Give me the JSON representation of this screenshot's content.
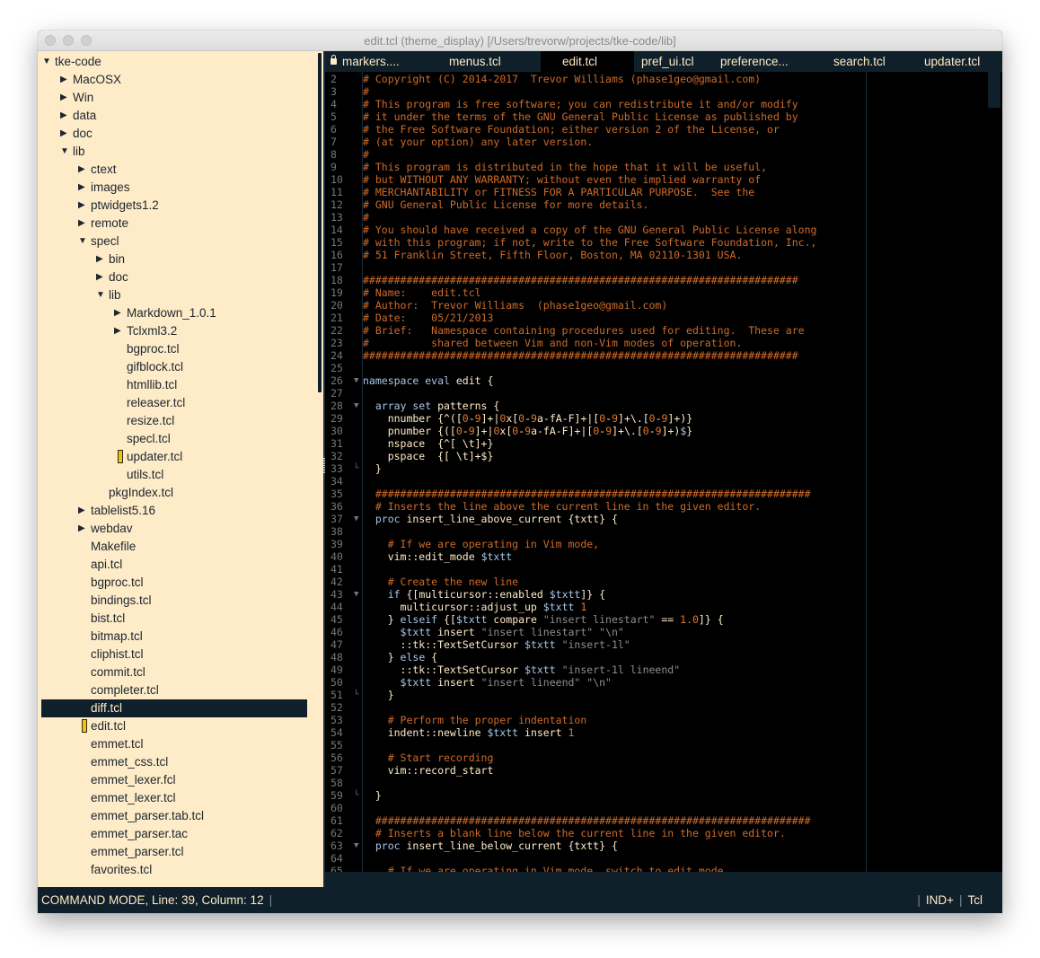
{
  "window": {
    "title": "edit.tcl (theme_display) [/Users/trevorw/projects/tke-code/lib]",
    "traffic_lights": [
      "close",
      "minimize",
      "zoom"
    ]
  },
  "colors": {
    "sidebar_bg": "#feebc7",
    "chrome_bg": "#0f202b",
    "editor_bg": "#000000",
    "comment": "#ce6b2a",
    "keyword": "#a9c6e6",
    "string": "#8e8e8e",
    "number": "#e3782c",
    "text": "#feebc7",
    "modified_marker": "#f5c400"
  },
  "sidebar": {
    "items": [
      {
        "label": "tke-code",
        "depth": 0,
        "type": "folder",
        "expanded": true
      },
      {
        "label": "MacOSX",
        "depth": 1,
        "type": "folder",
        "expanded": false
      },
      {
        "label": "Win",
        "depth": 1,
        "type": "folder",
        "expanded": false
      },
      {
        "label": "data",
        "depth": 1,
        "type": "folder",
        "expanded": false
      },
      {
        "label": "doc",
        "depth": 1,
        "type": "folder",
        "expanded": false
      },
      {
        "label": "lib",
        "depth": 1,
        "type": "folder",
        "expanded": true
      },
      {
        "label": "ctext",
        "depth": 2,
        "type": "folder",
        "expanded": false
      },
      {
        "label": "images",
        "depth": 2,
        "type": "folder",
        "expanded": false
      },
      {
        "label": "ptwidgets1.2",
        "depth": 2,
        "type": "folder",
        "expanded": false
      },
      {
        "label": "remote",
        "depth": 2,
        "type": "folder",
        "expanded": false
      },
      {
        "label": "specl",
        "depth": 2,
        "type": "folder",
        "expanded": true
      },
      {
        "label": "bin",
        "depth": 3,
        "type": "folder",
        "expanded": false
      },
      {
        "label": "doc",
        "depth": 3,
        "type": "folder",
        "expanded": false
      },
      {
        "label": "lib",
        "depth": 3,
        "type": "folder",
        "expanded": true
      },
      {
        "label": "Markdown_1.0.1",
        "depth": 4,
        "type": "folder",
        "expanded": false
      },
      {
        "label": "Tclxml3.2",
        "depth": 4,
        "type": "folder",
        "expanded": false
      },
      {
        "label": "bgproc.tcl",
        "depth": 4,
        "type": "file"
      },
      {
        "label": "gifblock.tcl",
        "depth": 4,
        "type": "file"
      },
      {
        "label": "htmllib.tcl",
        "depth": 4,
        "type": "file"
      },
      {
        "label": "releaser.tcl",
        "depth": 4,
        "type": "file"
      },
      {
        "label": "resize.tcl",
        "depth": 4,
        "type": "file"
      },
      {
        "label": "specl.tcl",
        "depth": 4,
        "type": "file"
      },
      {
        "label": "updater.tcl",
        "depth": 4,
        "type": "file",
        "open": true
      },
      {
        "label": "utils.tcl",
        "depth": 4,
        "type": "file"
      },
      {
        "label": "pkgIndex.tcl",
        "depth": 3,
        "type": "file"
      },
      {
        "label": "tablelist5.16",
        "depth": 2,
        "type": "folder",
        "expanded": false
      },
      {
        "label": "webdav",
        "depth": 2,
        "type": "folder",
        "expanded": false
      },
      {
        "label": "Makefile",
        "depth": 2,
        "type": "file"
      },
      {
        "label": "api.tcl",
        "depth": 2,
        "type": "file"
      },
      {
        "label": "bgproc.tcl",
        "depth": 2,
        "type": "file"
      },
      {
        "label": "bindings.tcl",
        "depth": 2,
        "type": "file"
      },
      {
        "label": "bist.tcl",
        "depth": 2,
        "type": "file"
      },
      {
        "label": "bitmap.tcl",
        "depth": 2,
        "type": "file"
      },
      {
        "label": "cliphist.tcl",
        "depth": 2,
        "type": "file"
      },
      {
        "label": "commit.tcl",
        "depth": 2,
        "type": "file"
      },
      {
        "label": "completer.tcl",
        "depth": 2,
        "type": "file"
      },
      {
        "label": "diff.tcl",
        "depth": 2,
        "type": "file",
        "selected": true
      },
      {
        "label": "edit.tcl",
        "depth": 2,
        "type": "file",
        "open": true
      },
      {
        "label": "emmet.tcl",
        "depth": 2,
        "type": "file"
      },
      {
        "label": "emmet_css.tcl",
        "depth": 2,
        "type": "file"
      },
      {
        "label": "emmet_lexer.fcl",
        "depth": 2,
        "type": "file"
      },
      {
        "label": "emmet_lexer.tcl",
        "depth": 2,
        "type": "file"
      },
      {
        "label": "emmet_parser.tab.tcl",
        "depth": 2,
        "type": "file"
      },
      {
        "label": "emmet_parser.tac",
        "depth": 2,
        "type": "file"
      },
      {
        "label": "emmet_parser.tcl",
        "depth": 2,
        "type": "file"
      },
      {
        "label": "favorites.tcl",
        "depth": 2,
        "type": "file"
      }
    ]
  },
  "tabs": [
    {
      "label": "markers....",
      "locked": true,
      "active": false
    },
    {
      "label": "menus.tcl",
      "active": false
    },
    {
      "label": "edit.tcl",
      "active": true
    },
    {
      "label": "pref_ui.tcl",
      "active": false
    },
    {
      "label": "preference...",
      "active": false
    },
    {
      "label": "search.tcl",
      "active": false
    },
    {
      "label": "updater.tcl",
      "active": false
    }
  ],
  "editor": {
    "lines": [
      {
        "n": 2,
        "t": [
          [
            "com",
            "# Copyright (C) 2014-2017  Trevor Williams (phase1geo@gmail.com)"
          ]
        ]
      },
      {
        "n": 3,
        "t": [
          [
            "com",
            "#"
          ]
        ]
      },
      {
        "n": 4,
        "t": [
          [
            "com",
            "# This program is free software; you can redistribute it and/or modify"
          ]
        ]
      },
      {
        "n": 5,
        "t": [
          [
            "com",
            "# it under the terms of the GNU General Public License as published by"
          ]
        ]
      },
      {
        "n": 6,
        "t": [
          [
            "com",
            "# the Free Software Foundation; either version 2 of the License, or"
          ]
        ]
      },
      {
        "n": 7,
        "t": [
          [
            "com",
            "# (at your option) any later version."
          ]
        ]
      },
      {
        "n": 8,
        "t": [
          [
            "com",
            "#"
          ]
        ]
      },
      {
        "n": 9,
        "t": [
          [
            "com",
            "# This program is distributed in the hope that it will be useful,"
          ]
        ]
      },
      {
        "n": 10,
        "t": [
          [
            "com",
            "# but WITHOUT ANY WARRANTY; without even the implied warranty of"
          ]
        ]
      },
      {
        "n": 11,
        "t": [
          [
            "com",
            "# MERCHANTABILITY or FITNESS FOR A PARTICULAR PURPOSE.  See the"
          ]
        ]
      },
      {
        "n": 12,
        "t": [
          [
            "com",
            "# GNU General Public License for more details."
          ]
        ]
      },
      {
        "n": 13,
        "t": [
          [
            "com",
            "#"
          ]
        ]
      },
      {
        "n": 14,
        "t": [
          [
            "com",
            "# You should have received a copy of the GNU General Public License along"
          ]
        ]
      },
      {
        "n": 15,
        "t": [
          [
            "com",
            "# with this program; if not, write to the Free Software Foundation, Inc.,"
          ]
        ]
      },
      {
        "n": 16,
        "t": [
          [
            "com",
            "# 51 Franklin Street, Fifth Floor, Boston, MA 02110-1301 USA."
          ]
        ]
      },
      {
        "n": 17,
        "t": []
      },
      {
        "n": 18,
        "t": [
          [
            "com",
            "######################################################################"
          ]
        ]
      },
      {
        "n": 19,
        "t": [
          [
            "com",
            "# Name:    edit.tcl"
          ]
        ]
      },
      {
        "n": 20,
        "t": [
          [
            "com",
            "# Author:  Trevor Williams  (phase1geo@gmail.com)"
          ]
        ]
      },
      {
        "n": 21,
        "t": [
          [
            "com",
            "# Date:    05/21/2013"
          ]
        ]
      },
      {
        "n": 22,
        "t": [
          [
            "com",
            "# Brief:   Namespace containing procedures used for editing.  These are"
          ]
        ]
      },
      {
        "n": 23,
        "t": [
          [
            "com",
            "#          shared between Vim and non-Vim modes of operation."
          ]
        ]
      },
      {
        "n": 24,
        "t": [
          [
            "com",
            "######################################################################"
          ]
        ]
      },
      {
        "n": 25,
        "t": []
      },
      {
        "n": 26,
        "fold": "open",
        "t": [
          [
            "kw",
            "namespace eval"
          ],
          [
            "txt",
            " edit {"
          ]
        ]
      },
      {
        "n": 27,
        "t": []
      },
      {
        "n": 28,
        "fold": "open",
        "t": [
          [
            "kw",
            "  array set"
          ],
          [
            "txt",
            " patterns {"
          ]
        ]
      },
      {
        "n": 29,
        "t": [
          [
            "txt",
            "    nnumber {^(["
          ],
          [
            "num",
            "0"
          ],
          [
            "txt",
            "-"
          ],
          [
            "num",
            "9"
          ],
          [
            "txt",
            "]+|"
          ],
          [
            "num",
            "0"
          ],
          [
            "txt",
            "x["
          ],
          [
            "num",
            "0"
          ],
          [
            "txt",
            "-"
          ],
          [
            "num",
            "9"
          ],
          [
            "txt",
            "a-fA-F]+|["
          ],
          [
            "num",
            "0"
          ],
          [
            "txt",
            "-"
          ],
          [
            "num",
            "9"
          ],
          [
            "txt",
            "]+\\.["
          ],
          [
            "num",
            "0"
          ],
          [
            "txt",
            "-"
          ],
          [
            "num",
            "9"
          ],
          [
            "txt",
            "]+)}"
          ]
        ]
      },
      {
        "n": 30,
        "t": [
          [
            "txt",
            "    pnumber {(["
          ],
          [
            "num",
            "0"
          ],
          [
            "txt",
            "-"
          ],
          [
            "num",
            "9"
          ],
          [
            "txt",
            "]+|"
          ],
          [
            "num",
            "0"
          ],
          [
            "txt",
            "x["
          ],
          [
            "num",
            "0"
          ],
          [
            "txt",
            "-"
          ],
          [
            "num",
            "9"
          ],
          [
            "txt",
            "a-fA-F]+|["
          ],
          [
            "num",
            "0"
          ],
          [
            "txt",
            "-"
          ],
          [
            "num",
            "9"
          ],
          [
            "txt",
            "]+\\.["
          ],
          [
            "num",
            "0"
          ],
          [
            "txt",
            "-"
          ],
          [
            "num",
            "9"
          ],
          [
            "txt",
            "]+)"
          ],
          [
            "var",
            "$"
          ],
          [
            "txt",
            "}"
          ]
        ]
      },
      {
        "n": 31,
        "t": [
          [
            "txt",
            "    nspace  {^[ \\t]+}"
          ]
        ]
      },
      {
        "n": 32,
        "t": [
          [
            "txt",
            "    pspace  {[ \\t]+$}"
          ]
        ]
      },
      {
        "n": 33,
        "fold": "end",
        "t": [
          [
            "txt",
            "  }"
          ]
        ]
      },
      {
        "n": 34,
        "t": []
      },
      {
        "n": 35,
        "t": [
          [
            "com",
            "  ######################################################################"
          ]
        ]
      },
      {
        "n": 36,
        "t": [
          [
            "com",
            "  # Inserts the line above the current line in the given editor."
          ]
        ]
      },
      {
        "n": 37,
        "fold": "open",
        "t": [
          [
            "kw",
            "  proc"
          ],
          [
            "txt",
            " insert_line_above_current {txtt} {"
          ]
        ]
      },
      {
        "n": 38,
        "t": []
      },
      {
        "n": 39,
        "t": [
          [
            "com",
            "    # If we are operating in Vim mode,"
          ]
        ]
      },
      {
        "n": 40,
        "t": [
          [
            "txt",
            "    vim::edit_mode "
          ],
          [
            "var",
            "$txtt"
          ]
        ]
      },
      {
        "n": 41,
        "t": []
      },
      {
        "n": 42,
        "t": [
          [
            "com",
            "    # Create the new line"
          ]
        ]
      },
      {
        "n": 43,
        "fold": "open",
        "t": [
          [
            "kw",
            "    if"
          ],
          [
            "txt",
            " {[multicursor::enabled "
          ],
          [
            "var",
            "$txtt"
          ],
          [
            "txt",
            "]} {"
          ]
        ]
      },
      {
        "n": 44,
        "t": [
          [
            "txt",
            "      multicursor::adjust_up "
          ],
          [
            "var",
            "$txtt"
          ],
          [
            "num",
            " 1"
          ]
        ]
      },
      {
        "n": 45,
        "t": [
          [
            "txt",
            "    } "
          ],
          [
            "kw",
            "elseif"
          ],
          [
            "txt",
            " {["
          ],
          [
            "var",
            "$txtt"
          ],
          [
            "txt",
            " compare "
          ],
          [
            "str",
            "\"insert linestart\""
          ],
          [
            "txt",
            " == "
          ],
          [
            "num",
            "1.0"
          ],
          [
            "txt",
            "]} {"
          ]
        ]
      },
      {
        "n": 46,
        "t": [
          [
            "var",
            "      $txtt"
          ],
          [
            "txt",
            " insert "
          ],
          [
            "str",
            "\"insert linestart\" \"\\n\""
          ]
        ]
      },
      {
        "n": 47,
        "t": [
          [
            "txt",
            "      ::tk::TextSetCursor "
          ],
          [
            "var",
            "$txtt"
          ],
          [
            "str",
            " \"insert-1l\""
          ]
        ]
      },
      {
        "n": 48,
        "t": [
          [
            "txt",
            "    } "
          ],
          [
            "kw",
            "else"
          ],
          [
            "txt",
            " {"
          ]
        ]
      },
      {
        "n": 49,
        "t": [
          [
            "txt",
            "      ::tk::TextSetCursor "
          ],
          [
            "var",
            "$txtt"
          ],
          [
            "str",
            " \"insert-1l lineend\""
          ]
        ]
      },
      {
        "n": 50,
        "t": [
          [
            "var",
            "      $txtt"
          ],
          [
            "txt",
            " insert "
          ],
          [
            "str",
            "\"insert lineend\" \"\\n\""
          ]
        ]
      },
      {
        "n": 51,
        "fold": "end",
        "t": [
          [
            "txt",
            "    }"
          ]
        ]
      },
      {
        "n": 52,
        "t": []
      },
      {
        "n": 53,
        "t": [
          [
            "com",
            "    # Perform the proper indentation"
          ]
        ]
      },
      {
        "n": 54,
        "t": [
          [
            "txt",
            "    indent::newline "
          ],
          [
            "var",
            "$txtt"
          ],
          [
            "txt",
            " insert "
          ],
          [
            "num",
            "1"
          ]
        ]
      },
      {
        "n": 55,
        "t": []
      },
      {
        "n": 56,
        "t": [
          [
            "com",
            "    # Start recording"
          ]
        ]
      },
      {
        "n": 57,
        "t": [
          [
            "txt",
            "    vim::record_start"
          ]
        ]
      },
      {
        "n": 58,
        "t": []
      },
      {
        "n": 59,
        "fold": "end",
        "t": [
          [
            "txt",
            "  }"
          ]
        ]
      },
      {
        "n": 60,
        "t": []
      },
      {
        "n": 61,
        "t": [
          [
            "com",
            "  ######################################################################"
          ]
        ]
      },
      {
        "n": 62,
        "t": [
          [
            "com",
            "  # Inserts a blank line below the current line in the given editor."
          ]
        ]
      },
      {
        "n": 63,
        "fold": "open",
        "t": [
          [
            "kw",
            "  proc"
          ],
          [
            "txt",
            " insert_line_below_current {txtt} {"
          ]
        ]
      },
      {
        "n": 64,
        "t": []
      },
      {
        "n": 65,
        "t": [
          [
            "com",
            "    # If we are operating in Vim mode, switch to edit mode"
          ]
        ]
      }
    ]
  },
  "statusbar": {
    "left": "COMMAND MODE, Line: 39, Column: 12",
    "indent_mode": "IND+",
    "language": "Tcl"
  }
}
